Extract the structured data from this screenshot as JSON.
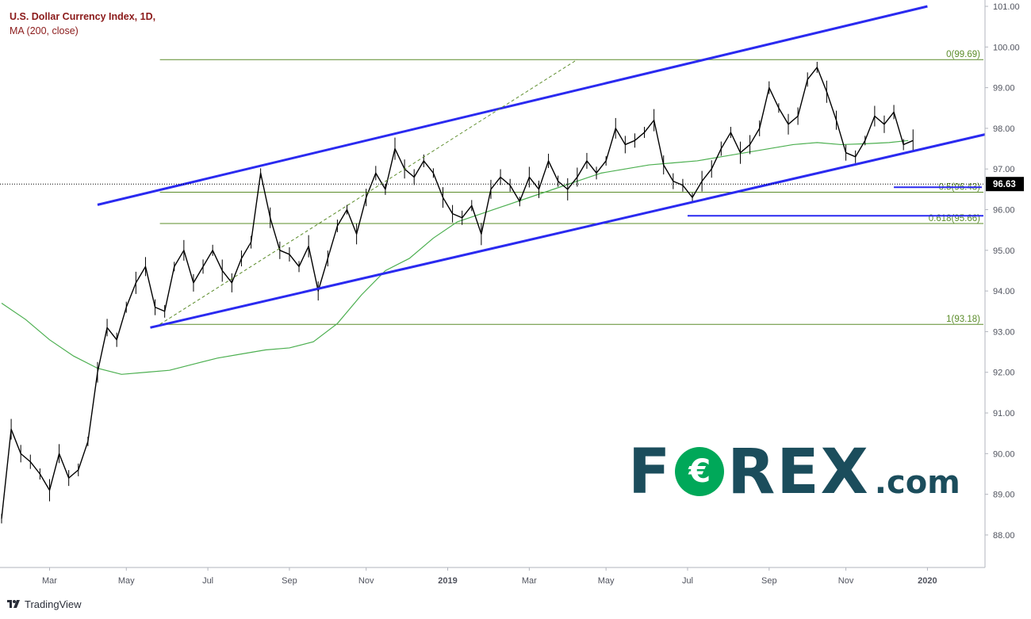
{
  "legend": {
    "title": "U.S. Dollar Currency Index, 1D,",
    "indicator": "MA (200, close)"
  },
  "branding": {
    "tradingview": "TradingView",
    "forex_prefix": "F",
    "forex_o": "€",
    "forex_suffix": "REX",
    "forex_domain": ".com"
  },
  "colors": {
    "price": "#000000",
    "ma": "#4caf50",
    "channel": "#2a2af0",
    "fib": "#5b8c2a",
    "last_price_bg": "#000000",
    "brand_dark": "#1b4d5c",
    "brand_green": "#00a859"
  },
  "chart_data": {
    "type": "line",
    "title": "U.S. Dollar Currency Index, 1D,",
    "ylim": [
      87.2,
      101.0
    ],
    "x_ticks": [
      {
        "label": "Mar",
        "t": 2018.17
      },
      {
        "label": "May",
        "t": 2018.33
      },
      {
        "label": "Jul",
        "t": 2018.5
      },
      {
        "label": "Sep",
        "t": 2018.67
      },
      {
        "label": "Nov",
        "t": 2018.83
      },
      {
        "label": "2019",
        "t": 2019.0
      },
      {
        "label": "Mar",
        "t": 2019.17
      },
      {
        "label": "May",
        "t": 2019.33
      },
      {
        "label": "Jul",
        "t": 2019.5
      },
      {
        "label": "Sep",
        "t": 2019.67
      },
      {
        "label": "Nov",
        "t": 2019.83
      },
      {
        "label": "2020",
        "t": 2020.0
      }
    ],
    "y_ticks": [
      "101.00",
      "100.00",
      "99.00",
      "98.00",
      "97.00",
      "96.00",
      "95.00",
      "94.00",
      "93.00",
      "92.00",
      "91.00",
      "90.00",
      "89.00",
      "88.00"
    ],
    "y_tick_values": [
      101,
      100,
      99,
      98,
      97,
      96,
      95,
      94,
      93,
      92,
      91,
      90,
      89,
      88
    ],
    "x_range": [
      2018.07,
      2020.12
    ],
    "series": [
      {
        "kind": "price",
        "x": [
          2018.07,
          2018.09,
          2018.11,
          2018.13,
          2018.15,
          2018.17,
          2018.19,
          2018.21,
          2018.23,
          2018.25,
          2018.27,
          2018.29,
          2018.31,
          2018.33,
          2018.35,
          2018.37,
          2018.39,
          2018.41,
          2018.43,
          2018.45,
          2018.47,
          2018.49,
          2018.51,
          2018.53,
          2018.55,
          2018.57,
          2018.59,
          2018.61,
          2018.63,
          2018.65,
          2018.67,
          2018.69,
          2018.71,
          2018.73,
          2018.75,
          2018.77,
          2018.79,
          2018.81,
          2018.83,
          2018.85,
          2018.87,
          2018.89,
          2018.91,
          2018.93,
          2018.95,
          2018.97,
          2018.99,
          2019.01,
          2019.03,
          2019.05,
          2019.07,
          2019.09,
          2019.11,
          2019.13,
          2019.15,
          2019.17,
          2019.19,
          2019.21,
          2019.23,
          2019.25,
          2019.27,
          2019.29,
          2019.31,
          2019.33,
          2019.35,
          2019.37,
          2019.39,
          2019.41,
          2019.43,
          2019.45,
          2019.47,
          2019.49,
          2019.51,
          2019.53,
          2019.55,
          2019.57,
          2019.59,
          2019.61,
          2019.63,
          2019.65,
          2019.67,
          2019.69,
          2019.71,
          2019.73,
          2019.75,
          2019.77,
          2019.79,
          2019.81,
          2019.83,
          2019.85,
          2019.87,
          2019.89,
          2019.91,
          2019.93,
          2019.95,
          2019.97
        ],
        "y": [
          88.4,
          90.6,
          90.0,
          89.8,
          89.5,
          89.1,
          90.0,
          89.4,
          89.6,
          90.3,
          92.0,
          93.1,
          92.8,
          93.6,
          94.2,
          94.6,
          93.6,
          93.5,
          94.6,
          95.0,
          94.2,
          94.6,
          95.0,
          94.5,
          94.2,
          94.8,
          95.2,
          96.9,
          95.8,
          95.0,
          94.9,
          94.6,
          95.1,
          94.0,
          94.8,
          95.6,
          96.0,
          95.4,
          96.3,
          96.9,
          96.5,
          97.5,
          97.0,
          96.8,
          97.2,
          96.9,
          96.3,
          95.9,
          95.8,
          96.1,
          95.4,
          96.5,
          96.8,
          96.6,
          96.2,
          96.8,
          96.5,
          97.2,
          96.7,
          96.5,
          96.8,
          97.2,
          96.9,
          97.2,
          98.0,
          97.6,
          97.7,
          97.9,
          98.2,
          97.1,
          96.7,
          96.6,
          96.3,
          96.7,
          97.0,
          97.5,
          97.9,
          97.4,
          97.6,
          98.0,
          99.0,
          98.5,
          98.1,
          98.3,
          99.2,
          99.5,
          98.9,
          98.2,
          97.4,
          97.3,
          97.7,
          98.3,
          98.1,
          98.4,
          97.6,
          97.7
        ]
      },
      {
        "kind": "ma200",
        "x": [
          2018.07,
          2018.12,
          2018.17,
          2018.22,
          2018.27,
          2018.32,
          2018.37,
          2018.42,
          2018.47,
          2018.52,
          2018.57,
          2018.62,
          2018.67,
          2018.72,
          2018.77,
          2018.82,
          2018.87,
          2018.92,
          2018.97,
          2019.02,
          2019.07,
          2019.12,
          2019.17,
          2019.22,
          2019.27,
          2019.32,
          2019.37,
          2019.42,
          2019.47,
          2019.52,
          2019.57,
          2019.62,
          2019.67,
          2019.72,
          2019.77,
          2019.82,
          2019.87,
          2019.92,
          2019.96
        ],
        "y": [
          93.7,
          93.3,
          92.8,
          92.4,
          92.1,
          91.95,
          92.0,
          92.05,
          92.2,
          92.35,
          92.45,
          92.55,
          92.6,
          92.75,
          93.2,
          93.9,
          94.5,
          94.8,
          95.3,
          95.7,
          95.9,
          96.1,
          96.3,
          96.5,
          96.7,
          96.9,
          97.0,
          97.1,
          97.15,
          97.2,
          97.3,
          97.4,
          97.5,
          97.6,
          97.65,
          97.6,
          97.62,
          97.65,
          97.7
        ]
      }
    ],
    "annotations": {
      "fib_levels": [
        {
          "label": "0(99.69)",
          "value": 99.69
        },
        {
          "label": "0.5(96.43)",
          "value": 96.43
        },
        {
          "label": "0.618(95.66)",
          "value": 95.66
        },
        {
          "label": "1(93.18)",
          "value": 93.18
        }
      ],
      "last_price": {
        "label": "96.63",
        "value": 96.63
      }
    }
  }
}
